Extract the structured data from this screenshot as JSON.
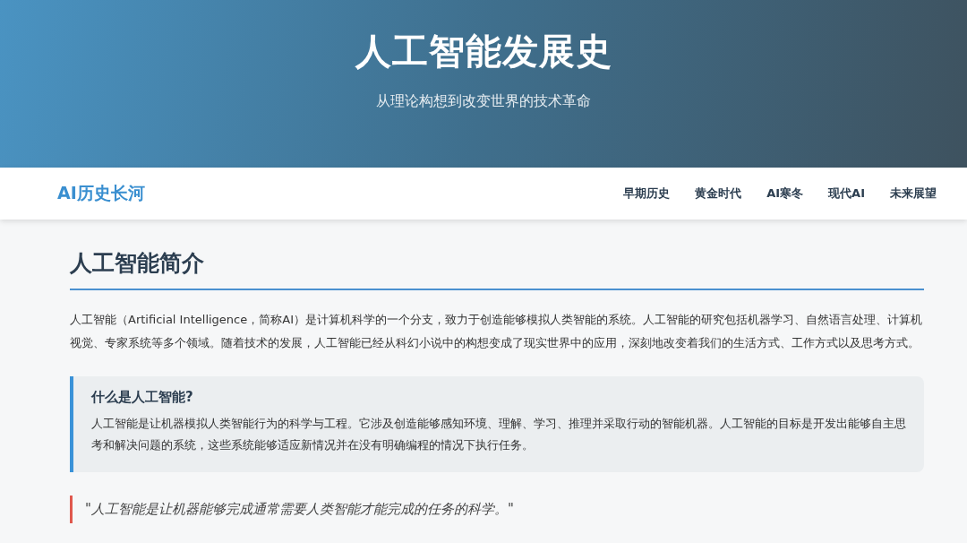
{
  "header": {
    "title": "人工智能发展史",
    "subtitle": "从理论构想到改变世界的技术革命"
  },
  "nav": {
    "logo": "AI历史长河",
    "items": [
      "早期历史",
      "黄金时代",
      "AI寒冬",
      "现代AI",
      "未来展望"
    ]
  },
  "section": {
    "heading": "人工智能简介",
    "paragraph": "人工智能（Artificial Intelligence，简称AI）是计算机科学的一个分支，致力于创造能够模拟人类智能的系统。人工智能的研究包括机器学习、自然语言处理、计算机视觉、专家系统等多个领域。随着技术的发展，人工智能已经从科幻小说中的构想变成了现实世界中的应用，深刻地改变着我们的生活方式、工作方式以及思考方式。",
    "info_box": {
      "title": "什么是人工智能?",
      "text": "人工智能是让机器模拟人类智能行为的科学与工程。它涉及创造能够感知环境、理解、学习、推理并采取行动的智能机器。人工智能的目标是开发出能够自主思考和解决问题的系统，这些系统能够适应新情况并在没有明确编程的情况下执行任务。"
    },
    "quote": "\"人工智能是让机器能够完成通常需要人类智能才能完成的任务的科学。\""
  }
}
